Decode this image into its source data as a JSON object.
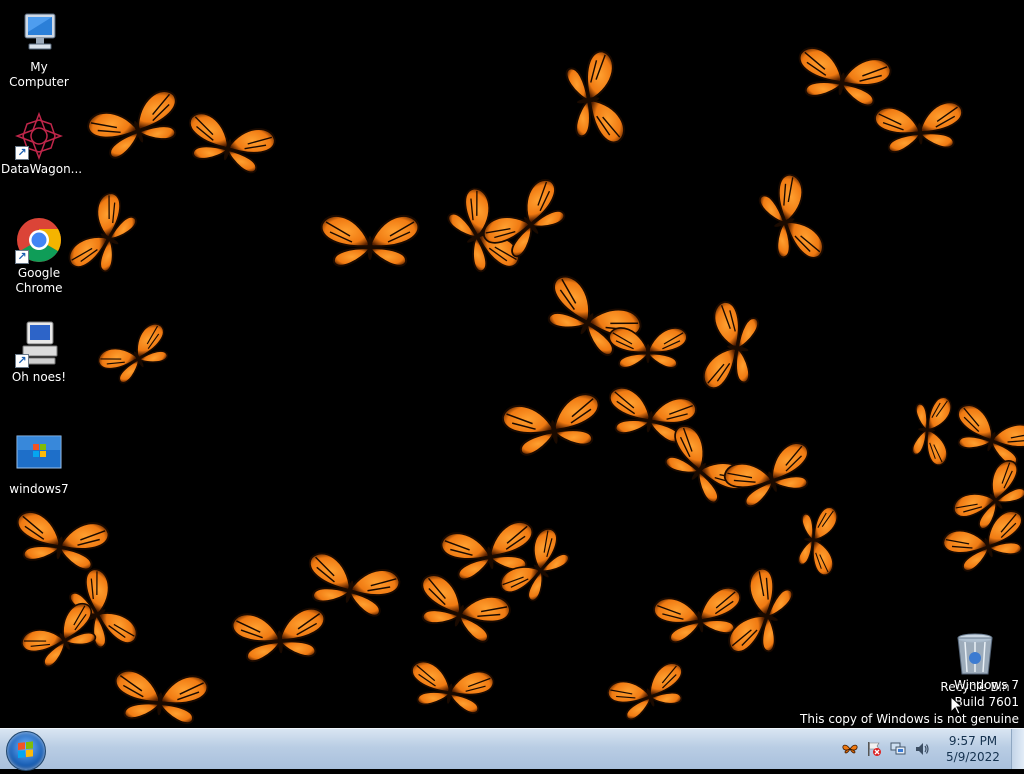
{
  "desktop": {
    "icons": [
      {
        "label": "My Computer",
        "icon": "computer-icon"
      },
      {
        "label": "DataWagon...",
        "icon": "datawagon-icon"
      },
      {
        "label": "Google Chrome",
        "icon": "chrome-icon"
      },
      {
        "label": "Oh noes!",
        "icon": "error-computer-icon"
      },
      {
        "label": "windows7",
        "icon": "windows7-image-icon"
      },
      {
        "label": "Recycle Bin",
        "icon": "recycle-bin-icon"
      }
    ],
    "wallpaper": "monarch-butterflies"
  },
  "watermark": {
    "line1": "Windows 7",
    "line2": "Build 7601",
    "line3": "This copy of Windows is not genuine"
  },
  "taskbar": {
    "start_icon": "windows-start-orb",
    "tray_icons": [
      "butterfly-icon",
      "action-center-flag-icon",
      "network-icon",
      "volume-icon"
    ],
    "clock": {
      "time": "9:57 PM",
      "date": "5/9/2022"
    }
  },
  "colors": {
    "butterfly_orange": "#f07a12",
    "butterfly_vein": "#1a0a00",
    "taskbar_top": "#d9e5f2",
    "taskbar_bottom": "#a9c0dc"
  }
}
